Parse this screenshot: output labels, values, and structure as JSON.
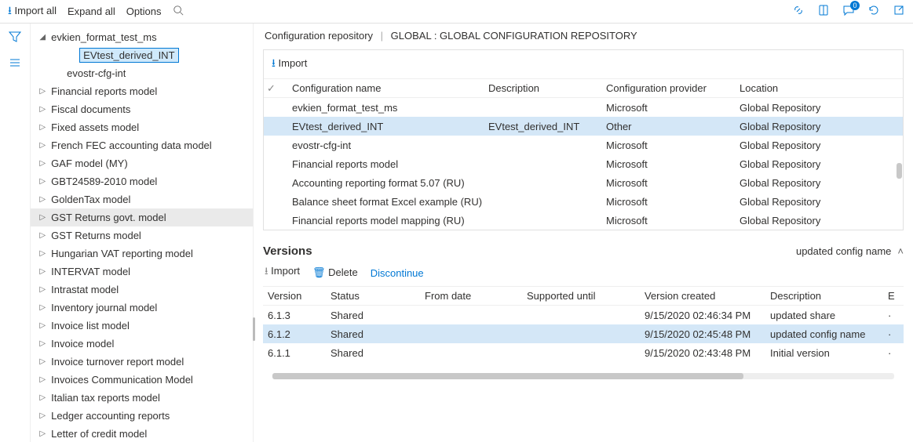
{
  "topbar": {
    "import_all": "Import all",
    "expand_all": "Expand all",
    "options": "Options",
    "badge_count": "0"
  },
  "breadcrumb": {
    "a": "Configuration repository",
    "b": "GLOBAL : GLOBAL CONFIGURATION REPOSITORY"
  },
  "tree": [
    {
      "level": 0,
      "expander": "◢",
      "label": "evkien_format_test_ms"
    },
    {
      "level": 2,
      "expander": "",
      "label": "EVtest_derived_INT",
      "selected": true
    },
    {
      "level": 1,
      "expander": "",
      "label": "evostr-cfg-int"
    },
    {
      "level": 0,
      "expander": "▷",
      "label": "Financial reports model"
    },
    {
      "level": 0,
      "expander": "▷",
      "label": "Fiscal documents"
    },
    {
      "level": 0,
      "expander": "▷",
      "label": "Fixed assets model"
    },
    {
      "level": 0,
      "expander": "▷",
      "label": "French FEC accounting data model"
    },
    {
      "level": 0,
      "expander": "▷",
      "label": "GAF model (MY)"
    },
    {
      "level": 0,
      "expander": "▷",
      "label": "GBT24589-2010 model"
    },
    {
      "level": 0,
      "expander": "▷",
      "label": "GoldenTax model"
    },
    {
      "level": 0,
      "expander": "▷",
      "label": "GST Returns govt. model",
      "hovered": true
    },
    {
      "level": 0,
      "expander": "▷",
      "label": "GST Returns model"
    },
    {
      "level": 0,
      "expander": "▷",
      "label": "Hungarian VAT reporting model"
    },
    {
      "level": 0,
      "expander": "▷",
      "label": "INTERVAT model"
    },
    {
      "level": 0,
      "expander": "▷",
      "label": "Intrastat model"
    },
    {
      "level": 0,
      "expander": "▷",
      "label": "Inventory journal model"
    },
    {
      "level": 0,
      "expander": "▷",
      "label": "Invoice list model"
    },
    {
      "level": 0,
      "expander": "▷",
      "label": "Invoice model"
    },
    {
      "level": 0,
      "expander": "▷",
      "label": "Invoice turnover report model"
    },
    {
      "level": 0,
      "expander": "▷",
      "label": "Invoices Communication Model"
    },
    {
      "level": 0,
      "expander": "▷",
      "label": "Italian tax reports model"
    },
    {
      "level": 0,
      "expander": "▷",
      "label": "Ledger accounting reports"
    },
    {
      "level": 0,
      "expander": "▷",
      "label": "Letter of credit model"
    }
  ],
  "grid": {
    "import_label": "Import",
    "headers": {
      "chk": "✓",
      "name": "Configuration name",
      "desc": "Description",
      "provider": "Configuration provider",
      "location": "Location"
    },
    "rows": [
      {
        "name": "evkien_format_test_ms",
        "desc": "",
        "provider": "Microsoft",
        "location": "Global Repository"
      },
      {
        "name": "EVtest_derived_INT",
        "desc": "EVtest_derived_INT",
        "provider": "Other",
        "location": "Global Repository",
        "selected": true
      },
      {
        "name": "evostr-cfg-int",
        "desc": "",
        "provider": "Microsoft",
        "location": "Global Repository"
      },
      {
        "name": "Financial reports model",
        "desc": "",
        "provider": "Microsoft",
        "location": "Global Repository"
      },
      {
        "name": "Accounting reporting format 5.07 (RU)",
        "desc": "",
        "provider": "Microsoft",
        "location": "Global Repository"
      },
      {
        "name": "Balance sheet format Excel example (RU)",
        "desc": "",
        "provider": "Microsoft",
        "location": "Global Repository"
      },
      {
        "name": "Financial reports model mapping (RU)",
        "desc": "",
        "provider": "Microsoft",
        "location": "Global Repository"
      }
    ]
  },
  "versions": {
    "title": "Versions",
    "subtitle": "updated config name",
    "toolbar": {
      "import": "Import",
      "delete": "Delete",
      "discontinue": "Discontinue"
    },
    "headers": {
      "version": "Version",
      "status": "Status",
      "from": "From date",
      "until": "Supported until",
      "created": "Version created",
      "desc": "Description",
      "e": "E"
    },
    "rows": [
      {
        "version": "6.1.3",
        "status": "Shared",
        "from": "",
        "until": "",
        "created": "9/15/2020 02:46:34 PM",
        "desc": "updated share"
      },
      {
        "version": "6.1.2",
        "status": "Shared",
        "from": "",
        "until": "",
        "created": "9/15/2020 02:45:48 PM",
        "desc": "updated config name",
        "selected": true
      },
      {
        "version": "6.1.1",
        "status": "Shared",
        "from": "",
        "until": "",
        "created": "9/15/2020 02:43:48 PM",
        "desc": "Initial version"
      }
    ]
  }
}
